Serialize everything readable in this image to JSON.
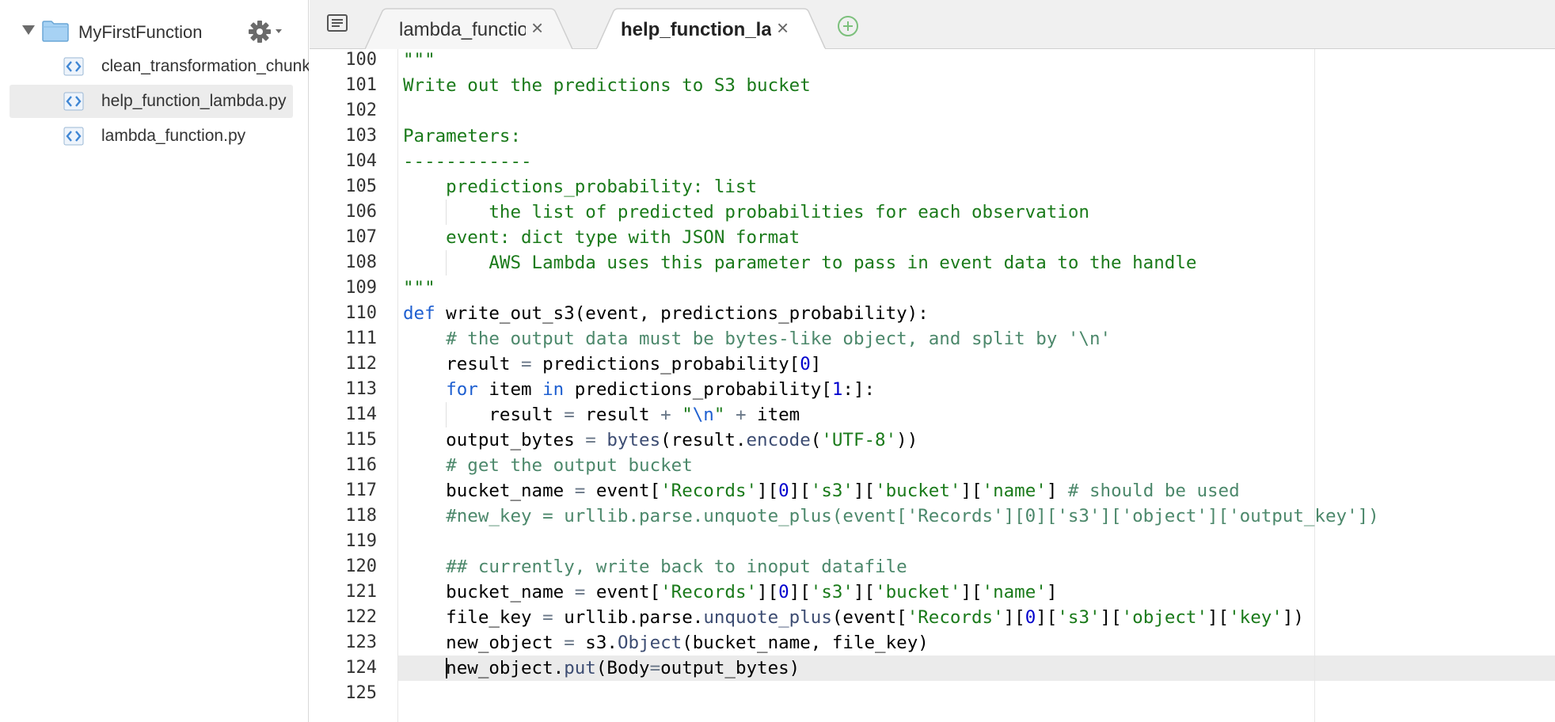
{
  "sidebar": {
    "folder": "MyFirstFunction",
    "files": [
      {
        "name": "clean_transformation_chunk.py",
        "selected": false
      },
      {
        "name": "help_function_lambda.py",
        "selected": true
      },
      {
        "name": "lambda_function.py",
        "selected": false
      }
    ]
  },
  "tabs": [
    {
      "label": "lambda_function.py",
      "active": false
    },
    {
      "label": "help_function_lambda.py",
      "active": true
    }
  ],
  "icons": {
    "folder": "folder-icon",
    "gear": "gear-icon",
    "file": "python-file-icon",
    "close": "close-icon",
    "add": "add-tab-icon",
    "menu": "file-list-menu-icon"
  },
  "colors": {
    "string": "#1a7a1a",
    "comment": "#4c886b",
    "keyword": "#1e5fd0",
    "number": "#0000cd",
    "active_line": "#ebebeb"
  },
  "editor": {
    "first_line_number": 100,
    "active_line": 124,
    "lines": [
      [
        [
          "s",
          "\"\"\""
        ]
      ],
      [
        [
          "s",
          "Write out the predictions to S3 bucket"
        ]
      ],
      [
        [
          "s",
          ""
        ]
      ],
      [
        [
          "s",
          "Parameters:"
        ]
      ],
      [
        [
          "s",
          "------------"
        ]
      ],
      [
        [
          "s",
          "    predictions_probability: list"
        ]
      ],
      [
        [
          "s",
          "        the list of predicted probabilities for each observation"
        ]
      ],
      [
        [
          "s",
          "    event: dict type with JSON format"
        ]
      ],
      [
        [
          "s",
          "        AWS Lambda uses this parameter to pass in event data to the handle"
        ]
      ],
      [
        [
          "s",
          "\"\"\""
        ]
      ],
      [
        [
          "k",
          "def"
        ],
        [
          "t",
          " write_out_s3(event, predictions_probability):"
        ]
      ],
      [
        [
          "t",
          "    "
        ],
        [
          "c",
          "# the output data must be bytes-like object, and split by '\\n'"
        ]
      ],
      [
        [
          "t",
          "    result "
        ],
        [
          "o",
          "="
        ],
        [
          "t",
          " predictions_probability["
        ],
        [
          "n",
          "0"
        ],
        [
          "t",
          "]"
        ]
      ],
      [
        [
          "t",
          "    "
        ],
        [
          "k",
          "for"
        ],
        [
          "t",
          " item "
        ],
        [
          "k",
          "in"
        ],
        [
          "t",
          " predictions_probability["
        ],
        [
          "n",
          "1"
        ],
        [
          "t",
          ":]:"
        ]
      ],
      [
        [
          "t",
          "        result "
        ],
        [
          "o",
          "="
        ],
        [
          "t",
          " result "
        ],
        [
          "o",
          "+"
        ],
        [
          "t",
          " "
        ],
        [
          "s",
          "\""
        ],
        [
          "k",
          "\\n"
        ],
        [
          "s",
          "\""
        ],
        [
          "t",
          " "
        ],
        [
          "o",
          "+"
        ],
        [
          "t",
          " item"
        ]
      ],
      [
        [
          "t",
          "    output_bytes "
        ],
        [
          "o",
          "="
        ],
        [
          "t",
          " "
        ],
        [
          "f",
          "bytes"
        ],
        [
          "t",
          "(result."
        ],
        [
          "f",
          "encode"
        ],
        [
          "t",
          "("
        ],
        [
          "s",
          "'UTF-8'"
        ],
        [
          "t",
          "))"
        ]
      ],
      [
        [
          "t",
          "    "
        ],
        [
          "c",
          "# get the output bucket"
        ]
      ],
      [
        [
          "t",
          "    bucket_name "
        ],
        [
          "o",
          "="
        ],
        [
          "t",
          " event["
        ],
        [
          "s",
          "'Records'"
        ],
        [
          "t",
          "]["
        ],
        [
          "n",
          "0"
        ],
        [
          "t",
          "]["
        ],
        [
          "s",
          "'s3'"
        ],
        [
          "t",
          "]["
        ],
        [
          "s",
          "'bucket'"
        ],
        [
          "t",
          "]["
        ],
        [
          "s",
          "'name'"
        ],
        [
          "t",
          "] "
        ],
        [
          "c",
          "# should be used"
        ]
      ],
      [
        [
          "t",
          "    "
        ],
        [
          "c",
          "#new_key = urllib.parse.unquote_plus(event['Records'][0]['s3']['object']['output_key'])"
        ]
      ],
      [
        [
          "t",
          ""
        ]
      ],
      [
        [
          "t",
          "    "
        ],
        [
          "c",
          "## currently, write back to inoput datafile"
        ]
      ],
      [
        [
          "t",
          "    bucket_name "
        ],
        [
          "o",
          "="
        ],
        [
          "t",
          " event["
        ],
        [
          "s",
          "'Records'"
        ],
        [
          "t",
          "]["
        ],
        [
          "n",
          "0"
        ],
        [
          "t",
          "]["
        ],
        [
          "s",
          "'s3'"
        ],
        [
          "t",
          "]["
        ],
        [
          "s",
          "'bucket'"
        ],
        [
          "t",
          "]["
        ],
        [
          "s",
          "'name'"
        ],
        [
          "t",
          "]"
        ]
      ],
      [
        [
          "t",
          "    file_key "
        ],
        [
          "o",
          "="
        ],
        [
          "t",
          " urllib.parse."
        ],
        [
          "f",
          "unquote_plus"
        ],
        [
          "t",
          "(event["
        ],
        [
          "s",
          "'Records'"
        ],
        [
          "t",
          "]["
        ],
        [
          "n",
          "0"
        ],
        [
          "t",
          "]["
        ],
        [
          "s",
          "'s3'"
        ],
        [
          "t",
          "]["
        ],
        [
          "s",
          "'object'"
        ],
        [
          "t",
          "]["
        ],
        [
          "s",
          "'key'"
        ],
        [
          "t",
          "])"
        ]
      ],
      [
        [
          "t",
          "    new_object "
        ],
        [
          "o",
          "="
        ],
        [
          "t",
          " s3."
        ],
        [
          "f",
          "Object"
        ],
        [
          "t",
          "(bucket_name, file_key)"
        ]
      ],
      [
        [
          "t",
          "    new_object."
        ],
        [
          "f",
          "put"
        ],
        [
          "t",
          "(Body"
        ],
        [
          "o",
          "="
        ],
        [
          "t",
          "output_bytes)"
        ]
      ],
      [
        [
          "t",
          ""
        ]
      ]
    ]
  }
}
